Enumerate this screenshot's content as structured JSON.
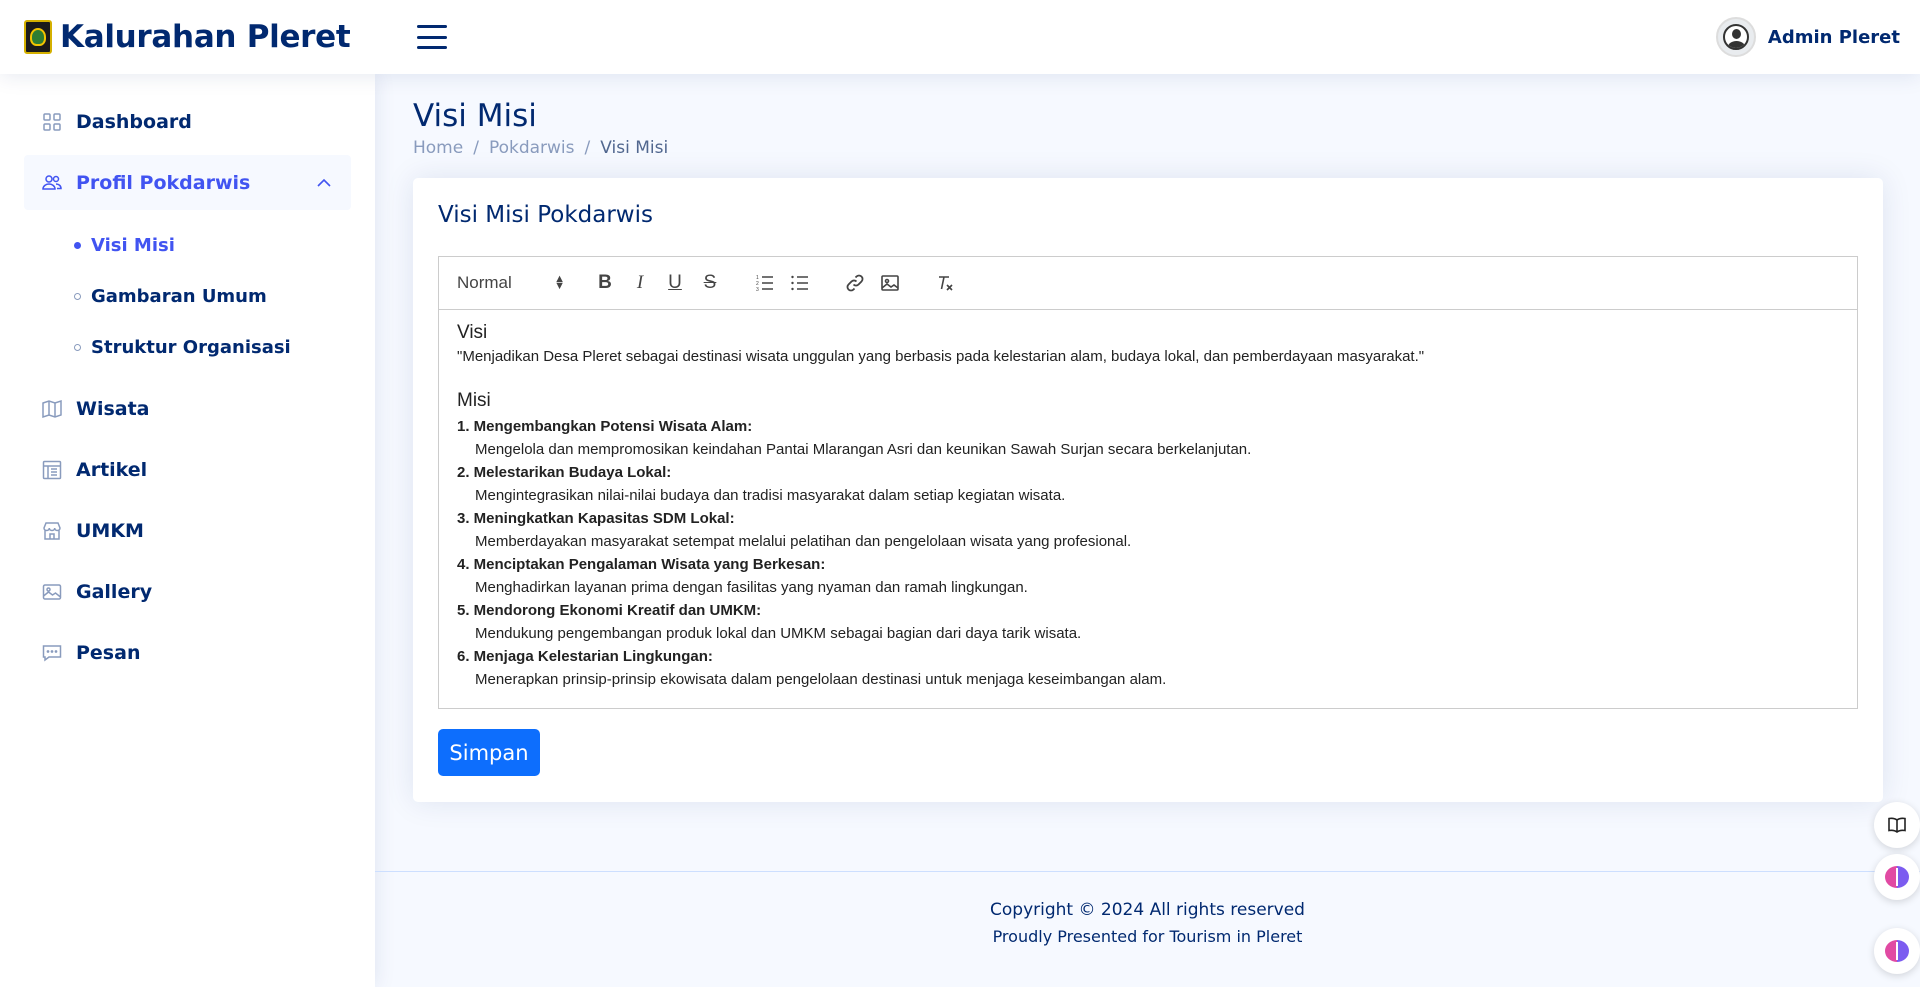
{
  "header": {
    "logo_text": "Kalurahan Pleret",
    "profile_name": "Admin Pleret"
  },
  "sidebar": {
    "items": [
      {
        "label": "Dashboard",
        "icon": "grid-icon"
      },
      {
        "label": "Profil Pokdarwis",
        "icon": "people-icon",
        "expanded": true
      },
      {
        "label": "Wisata",
        "icon": "map-icon"
      },
      {
        "label": "Artikel",
        "icon": "layout-text-icon"
      },
      {
        "label": "UMKM",
        "icon": "shop-icon"
      },
      {
        "label": "Gallery",
        "icon": "image-icon"
      },
      {
        "label": "Pesan",
        "icon": "chat-dots-icon"
      }
    ],
    "sub_items": [
      {
        "label": "Visi Misi",
        "active": true
      },
      {
        "label": "Gambaran Umum"
      },
      {
        "label": "Struktur Organisasi"
      }
    ]
  },
  "page": {
    "title": "Visi Misi",
    "breadcrumb": [
      "Home",
      "Pokdarwis",
      "Visi Misi"
    ]
  },
  "card": {
    "title": "Visi Misi Pokdarwis",
    "save_label": "Simpan"
  },
  "editor": {
    "format_select": "Normal",
    "visi_heading": "Visi",
    "visi_text": "\"Menjadikan Desa Pleret sebagai destinasi wisata unggulan yang berbasis pada kelestarian alam, budaya lokal, dan pemberdayaan masyarakat.\"",
    "misi_heading": "Misi",
    "misi": [
      {
        "title": "1. Mengembangkan Potensi Wisata Alam:",
        "desc": "Mengelola dan mempromosikan keindahan Pantai Mlarangan Asri dan keunikan Sawah Surjan secara berkelanjutan."
      },
      {
        "title": "2. Melestarikan Budaya Lokal:",
        "desc": "Mengintegrasikan nilai-nilai budaya dan tradisi masyarakat dalam setiap kegiatan wisata."
      },
      {
        "title": "3. Meningkatkan Kapasitas SDM Lokal:",
        "desc": "Memberdayakan masyarakat setempat melalui pelatihan dan pengelolaan wisata yang profesional."
      },
      {
        "title": "4. Menciptakan Pengalaman Wisata yang Berkesan:",
        "desc": "Menghadirkan layanan prima dengan fasilitas yang nyaman dan ramah lingkungan."
      },
      {
        "title": "5. Mendorong Ekonomi Kreatif dan UMKM:",
        "desc": "Mendukung pengembangan produk lokal dan UMKM sebagai bagian dari daya tarik wisata."
      },
      {
        "title": "6. Menjaga Kelestarian Lingkungan:",
        "desc": "Menerapkan prinsip-prinsip ekowisata dalam pengelolaan destinasi untuk menjaga keseimbangan alam."
      }
    ]
  },
  "footer": {
    "copyright": "Copyright © 2024 All rights reserved",
    "credit": "Proudly Presented for Tourism in Pleret"
  },
  "colors": {
    "primary_text": "#012970",
    "accent": "#4154f1",
    "button": "#0d6efd",
    "background": "#f6f9ff"
  }
}
